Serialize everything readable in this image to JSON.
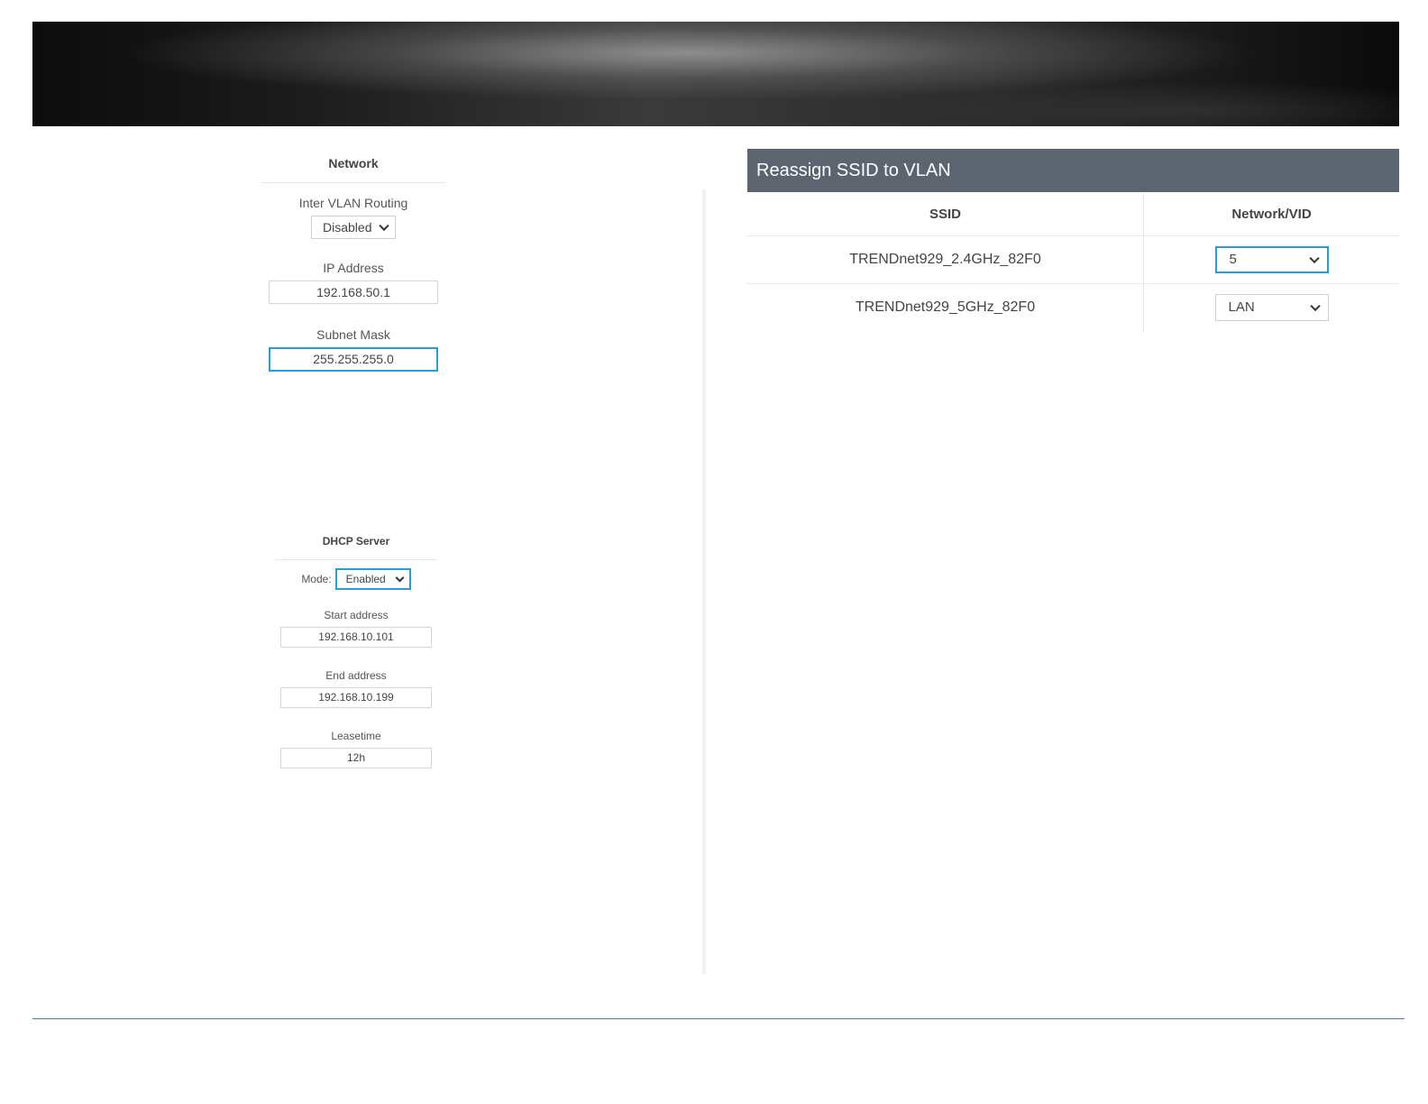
{
  "network": {
    "title": "Network",
    "inter_vlan_label": "Inter VLAN Routing",
    "inter_vlan_value": "Disabled",
    "ip_label": "IP Address",
    "ip_value": "192.168.50.1",
    "subnet_label": "Subnet Mask",
    "subnet_value": "255.255.255.0"
  },
  "dhcp": {
    "title": "DHCP Server",
    "mode_label": "Mode:",
    "mode_value": "Enabled",
    "start_label": "Start address",
    "start_value": "192.168.10.101",
    "end_label": "End address",
    "end_value": "192.168.10.199",
    "lease_label": "Leasetime",
    "lease_value": "12h"
  },
  "reassign": {
    "title": "Reassign SSID to VLAN",
    "col_ssid": "SSID",
    "col_vid": "Network/VID",
    "rows": [
      {
        "ssid": "TRENDnet929_2.4GHz_82F0",
        "vid": "5"
      },
      {
        "ssid": "TRENDnet929_5GHz_82F0",
        "vid": "LAN"
      }
    ]
  },
  "colors": {
    "header_bg": "#5c6470",
    "focus_border": "#2a9bd5",
    "footer_line": "#3a7fc1"
  }
}
